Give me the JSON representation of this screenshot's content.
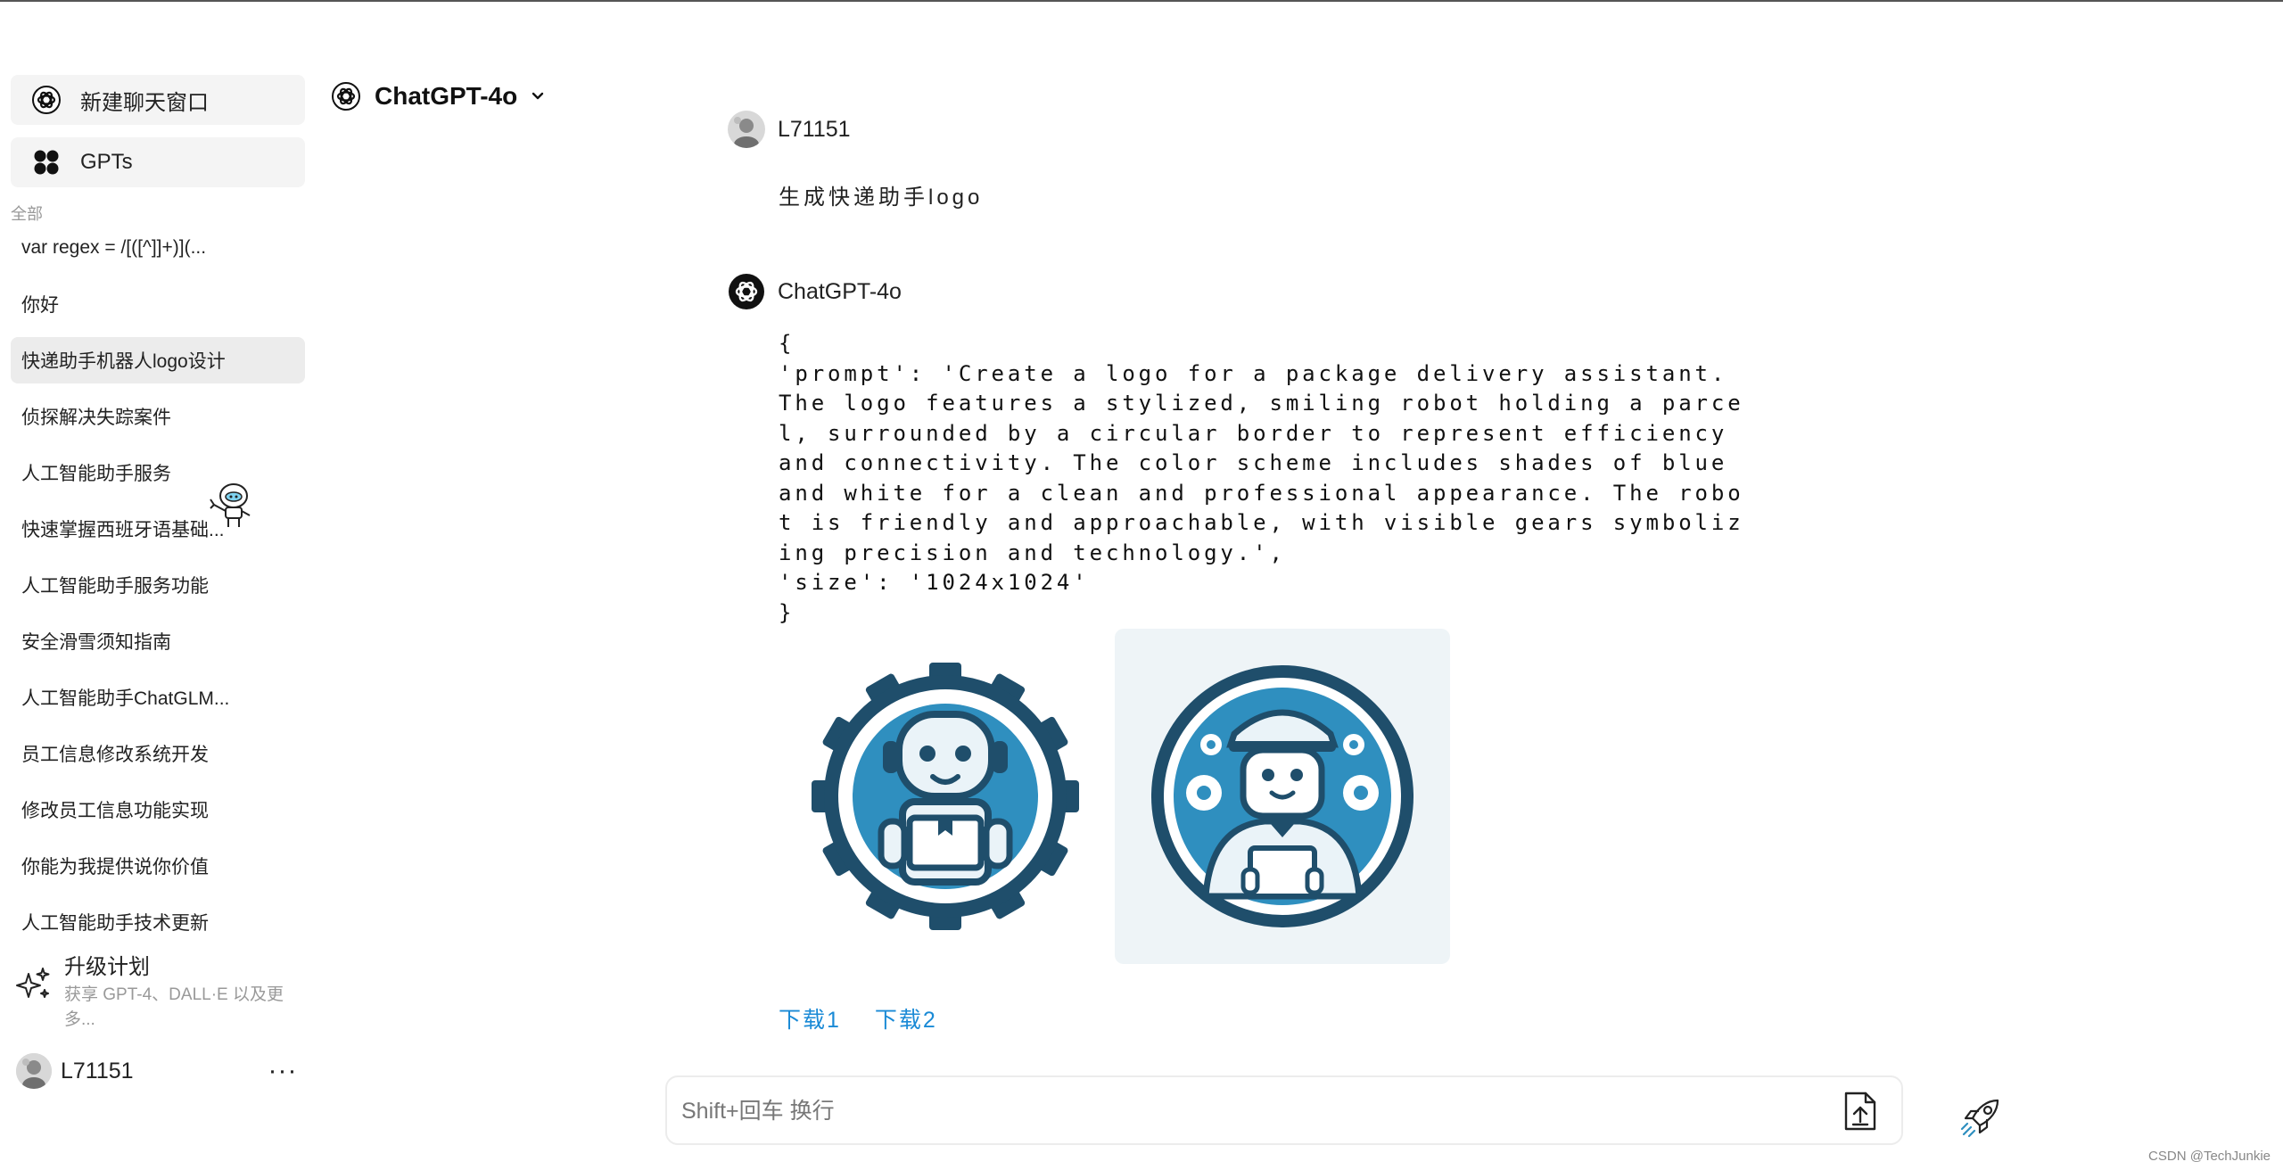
{
  "sidebar": {
    "new_chat_label": "新建聊天窗口",
    "gpts_label": "GPTs",
    "section_label": "全部",
    "history": [
      "var regex = /[([^]]+)](...",
      "你好",
      "快递助手机器人logo设计",
      "侦探解决失踪案件",
      "人工智能助手服务",
      "快速掌握西班牙语基础...",
      "人工智能助手服务功能",
      "安全滑雪须知指南",
      "人工智能助手ChatGLM...",
      "员工信息修改系统开发",
      "修改员工信息功能实现",
      "你能为我提供说你价值",
      "人工智能助手技术更新"
    ],
    "active_index": 2,
    "upgrade_title": "升级计划",
    "upgrade_subtitle": "获享 GPT-4、DALL·E 以及更多...",
    "user_name": "L71151",
    "more_label": "···"
  },
  "header": {
    "model_name": "ChatGPT-4o"
  },
  "chat": {
    "user_name": "L71151",
    "user_message": "生成快递助手logo",
    "bot_name": "ChatGPT-4o",
    "bot_message": "{\n'prompt': 'Create a logo for a package delivery assistant. The logo features a stylized, smiling robot holding a parcel, surrounded by a circular border to represent efficiency and connectivity. The color scheme includes shades of blue and white for a clean and professional appearance. The robot is friendly and approachable, with visible gears symbolizing precision and technology.',\n'size': '1024x1024'\n}",
    "download_1": "下载1",
    "download_2": "下载2"
  },
  "composer": {
    "placeholder": "Shift+回车 换行",
    "value": ""
  },
  "watermark": "CSDN @TechJunkie",
  "colors": {
    "link": "#1a8ad6",
    "logo_dark": "#1f4e6b",
    "logo_mid": "#2f8fbf",
    "logo_light": "#e6f2f7"
  },
  "icons": [
    "openai-icon",
    "gpts-grid-icon",
    "chevron-down-icon",
    "sparkle-icon",
    "upload-file-icon",
    "rocket-send-icon",
    "robot-mascot-icon"
  ]
}
